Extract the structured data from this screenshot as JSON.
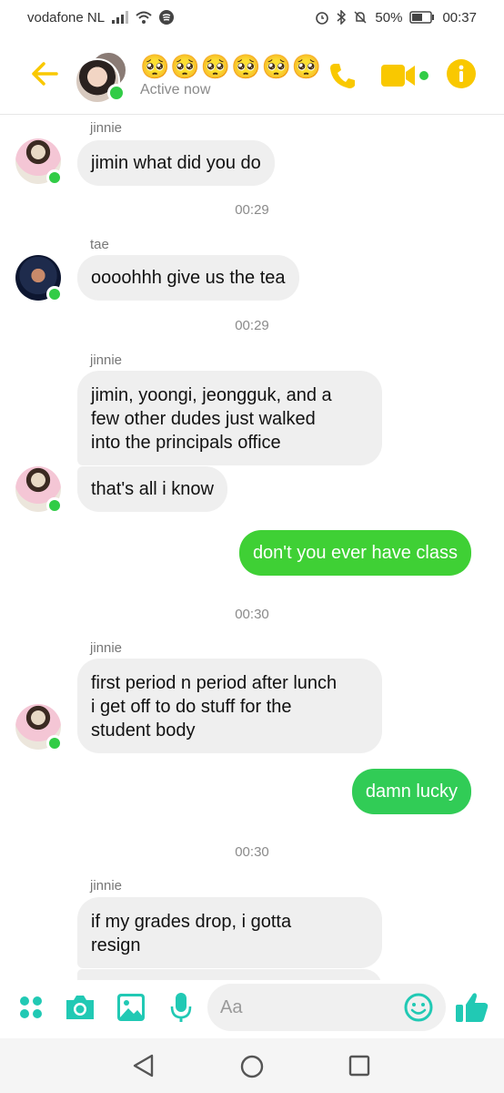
{
  "status_bar": {
    "carrier": "vodafone NL",
    "battery": "50%",
    "time": "00:37"
  },
  "header": {
    "title": "🥺🥺🥺🥺🥺🥺",
    "subtitle": "Active now",
    "accent_color": "#f9c800"
  },
  "messages": [
    {
      "sender": "jinnie",
      "text": "jimin what did you do"
    },
    {
      "time": "00:29"
    },
    {
      "sender": "tae",
      "text": "oooohhh give us the tea"
    },
    {
      "time": "00:29"
    },
    {
      "sender": "jinnie",
      "lines": [
        "jimin, yoongi, jeongguk, and a",
        "few other dudes just walked",
        "into the principals office"
      ]
    },
    {
      "text": "that's all i know"
    },
    {
      "outgoing": true,
      "text": "don't you ever have class"
    },
    {
      "time": "00:30"
    },
    {
      "sender": "jinnie",
      "lines": [
        "first period n period after lunch",
        "i get off to do stuff for the",
        "student body"
      ]
    },
    {
      "outgoing": true,
      "text": "damn lucky"
    },
    {
      "time": "00:30"
    },
    {
      "sender": "jinnie",
      "lines": [
        "if my grades drop, i gotta",
        "resign"
      ]
    }
  ],
  "composer": {
    "placeholder": "Aa",
    "icons": [
      "menu-dots-icon",
      "camera-icon",
      "image-icon",
      "microphone-icon",
      "emoji-icon",
      "thumbs-up-icon"
    ],
    "icon_color": "#21c9b4"
  },
  "nav": {
    "icons": [
      "back-triangle-icon",
      "home-circle-icon",
      "recents-square-icon"
    ]
  }
}
